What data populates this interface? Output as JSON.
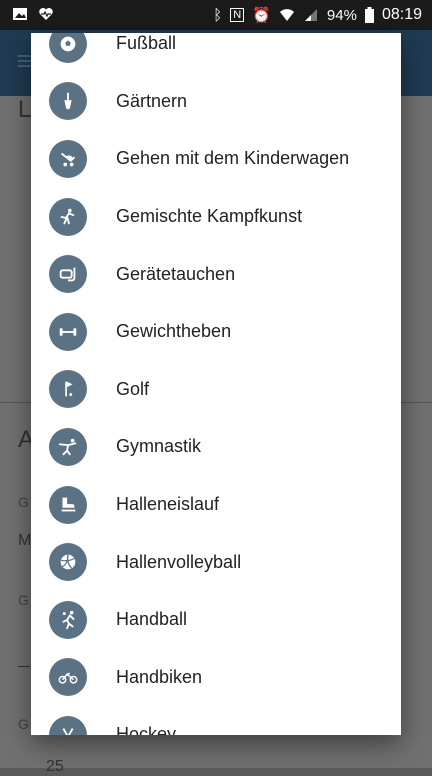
{
  "status_bar": {
    "battery": "94%",
    "time": "08:19"
  },
  "background_fragments": [
    "L",
    "A",
    "G",
    "M",
    "G",
    "G",
    "25"
  ],
  "dialog": {
    "items": [
      {
        "label": "Fußball",
        "icon": "soccer-ball-icon"
      },
      {
        "label": "Gärtnern",
        "icon": "trowel-icon"
      },
      {
        "label": "Gehen mit dem Kinderwagen",
        "icon": "stroller-icon"
      },
      {
        "label": "Gemischte Kampfkunst",
        "icon": "martial-arts-icon"
      },
      {
        "label": "Gerätetauchen",
        "icon": "diving-mask-icon"
      },
      {
        "label": "Gewichtheben",
        "icon": "dumbbell-icon"
      },
      {
        "label": "Golf",
        "icon": "golf-flag-icon"
      },
      {
        "label": "Gymnastik",
        "icon": "gymnastics-icon"
      },
      {
        "label": "Halleneislauf",
        "icon": "ice-skate-icon"
      },
      {
        "label": "Hallenvolleyball",
        "icon": "volleyball-icon"
      },
      {
        "label": "Handball",
        "icon": "handball-icon"
      },
      {
        "label": "Handbiken",
        "icon": "handbike-icon"
      },
      {
        "label": "Hockey",
        "icon": "hockey-icon"
      }
    ]
  },
  "colors": {
    "icon_circle": "#5b7284",
    "status_bar": "#1b1b1b",
    "app_bar": "#1f3b52"
  }
}
